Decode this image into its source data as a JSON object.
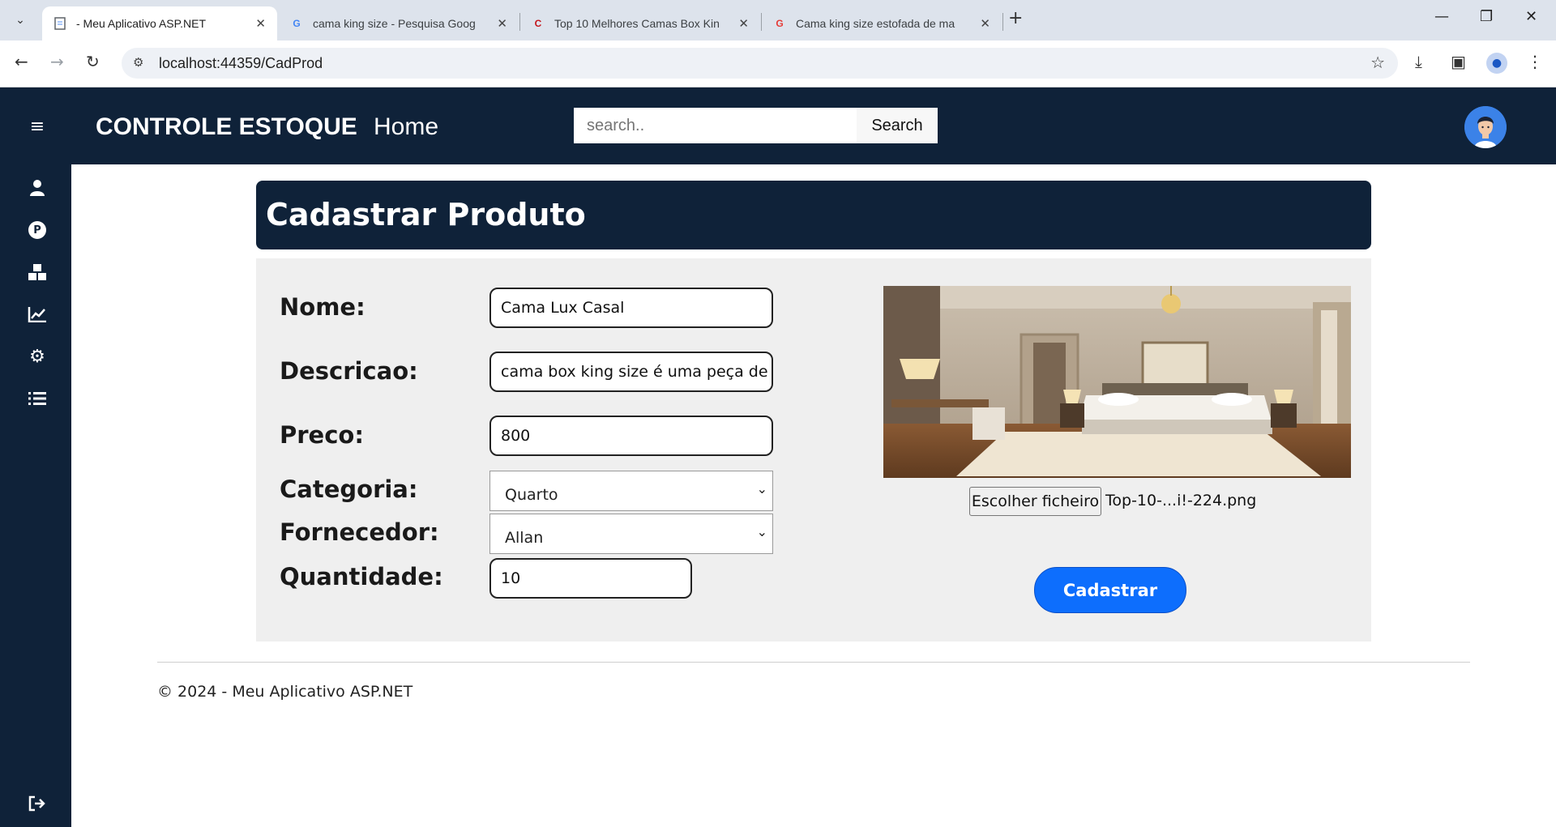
{
  "browser": {
    "tabs": [
      {
        "title": "- Meu Aplicativo ASP.NET",
        "icon": "page-icon",
        "active": true
      },
      {
        "title": "cama king size - Pesquisa Goog",
        "icon": "google-icon",
        "active": false
      },
      {
        "title": "Top 10 Melhores Camas Box Kin",
        "icon": "site-icon",
        "active": false
      },
      {
        "title": "Cama king size estofada de ma",
        "icon": "site-icon",
        "active": false
      }
    ],
    "url": "localhost:44359/CadProd"
  },
  "navbar": {
    "brand": "CONTROLE ESTOQUE",
    "home": "Home",
    "search_placeholder": "search..",
    "search_button": "Search"
  },
  "sidebar": {
    "items": [
      "menu-icon",
      "user-icon",
      "product-icon",
      "boxes-icon",
      "chart-line-icon",
      "gears-icon",
      "list-icon",
      "sign-out-icon"
    ]
  },
  "page": {
    "title": "Cadastrar Produto"
  },
  "form": {
    "nome_label": "Nome:",
    "nome_value": "Cama Lux Casal",
    "descricao_label": "Descricao:",
    "descricao_value": "cama box king size é uma peça de m",
    "preco_label": "Preco:",
    "preco_value": "800",
    "categoria_label": "Categoria:",
    "categoria_value": "Quarto",
    "fornecedor_label": "Fornecedor:",
    "fornecedor_value": "Allan",
    "quantidade_label": "Quantidade:",
    "quantidade_value": "10",
    "file_button": "Escolher ficheiro",
    "file_name": "Top-10-...i!-224.png",
    "submit": "Cadastrar"
  },
  "footer": {
    "text": "© 2024 - Meu Aplicativo ASP.NET"
  },
  "colors": {
    "navy": "#0f2239",
    "primary": "#0d6efd",
    "panel": "#efefef"
  }
}
